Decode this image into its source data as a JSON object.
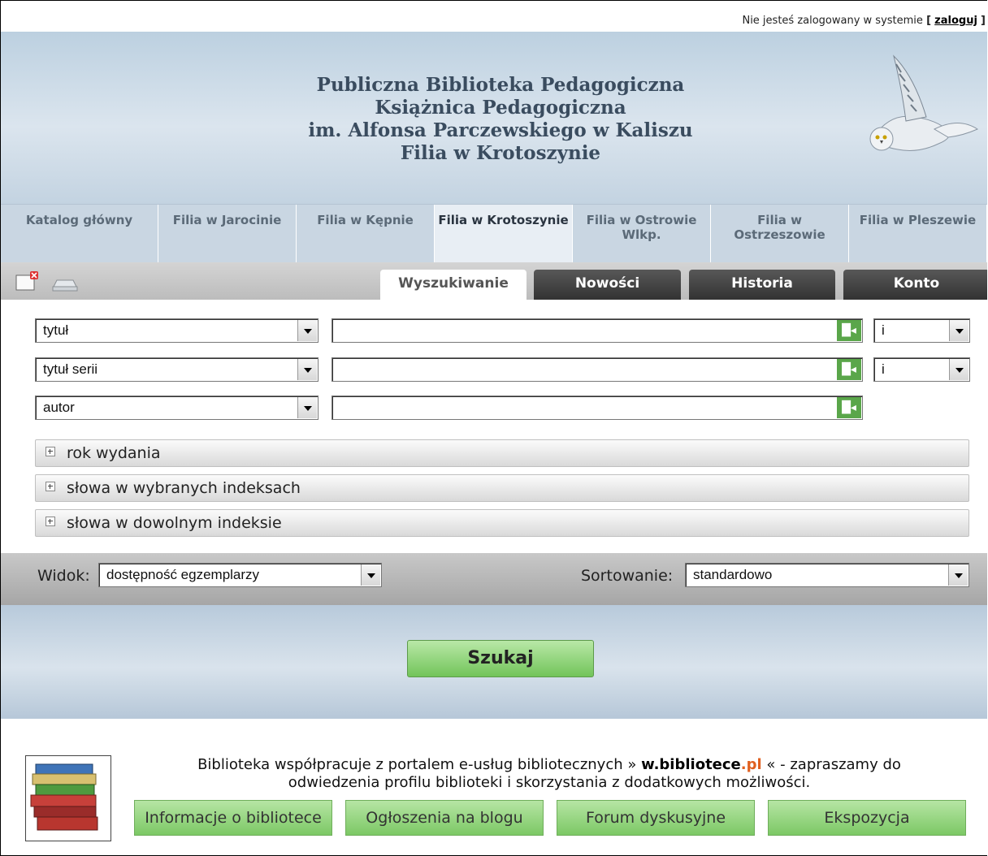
{
  "topbar": {
    "login_text": "Nie jesteś zalogowany w systemie",
    "open_bracket": "[",
    "login_link": "zaloguj",
    "close_bracket": "]"
  },
  "header": {
    "title_lines": [
      "Publiczna Biblioteka Pedagogiczna",
      "Książnica Pedagogiczna",
      "im. Alfonsa Parczewskiego w Kaliszu",
      "Filia w Krotoszynie"
    ]
  },
  "branches": [
    {
      "label": "Katalog główny",
      "active": false
    },
    {
      "label": "Filia w Jarocinie",
      "active": false
    },
    {
      "label": "Filia w Kępnie",
      "active": false
    },
    {
      "label": "Filia w Krotoszynie",
      "active": true
    },
    {
      "label": "Filia w Ostrowie Wlkp.",
      "active": false
    },
    {
      "label": "Filia w Ostrzeszowie",
      "active": false
    },
    {
      "label": "Filia w Pleszewie",
      "active": false
    }
  ],
  "tabs": [
    {
      "label": "Wyszukiwanie",
      "active": true
    },
    {
      "label": "Nowości",
      "active": false
    },
    {
      "label": "Historia",
      "active": false
    },
    {
      "label": "Konto",
      "active": false
    }
  ],
  "search_rows": [
    {
      "field": "tytuł",
      "value": "",
      "operator": "i"
    },
    {
      "field": "tytuł serii",
      "value": "",
      "operator": "i"
    },
    {
      "field": "autor",
      "value": "",
      "operator": ""
    }
  ],
  "expanders": [
    "rok wydania",
    "słowa w wybranych indeksach",
    "słowa w dowolnym indeksie"
  ],
  "view": {
    "view_label": "Widok:",
    "view_value": "dostępność egzemplarzy",
    "sort_label": "Sortowanie:",
    "sort_value": "standardowo"
  },
  "search_button": "Szukaj",
  "footer": {
    "text_before": "Biblioteka współpracuje z portalem e-usług bibliotecznych »",
    "portal_name": "w.bibliotece",
    "portal_tld": ".pl",
    "text_after": "« - zapraszamy do odwiedzenia profilu biblioteki i skorzystania z dodatkowych możliwości.",
    "buttons": [
      "Informacje o bibliotece",
      "Ogłoszenia na blogu",
      "Forum dyskusyjne",
      "Ekspozycja"
    ]
  },
  "colors": {
    "header_blue": "#c9d6e2",
    "tab_dark": "#3a3a3a",
    "green_button": "#72c45a",
    "index_button": "#5aa64a",
    "portal_orange": "#e06020"
  }
}
